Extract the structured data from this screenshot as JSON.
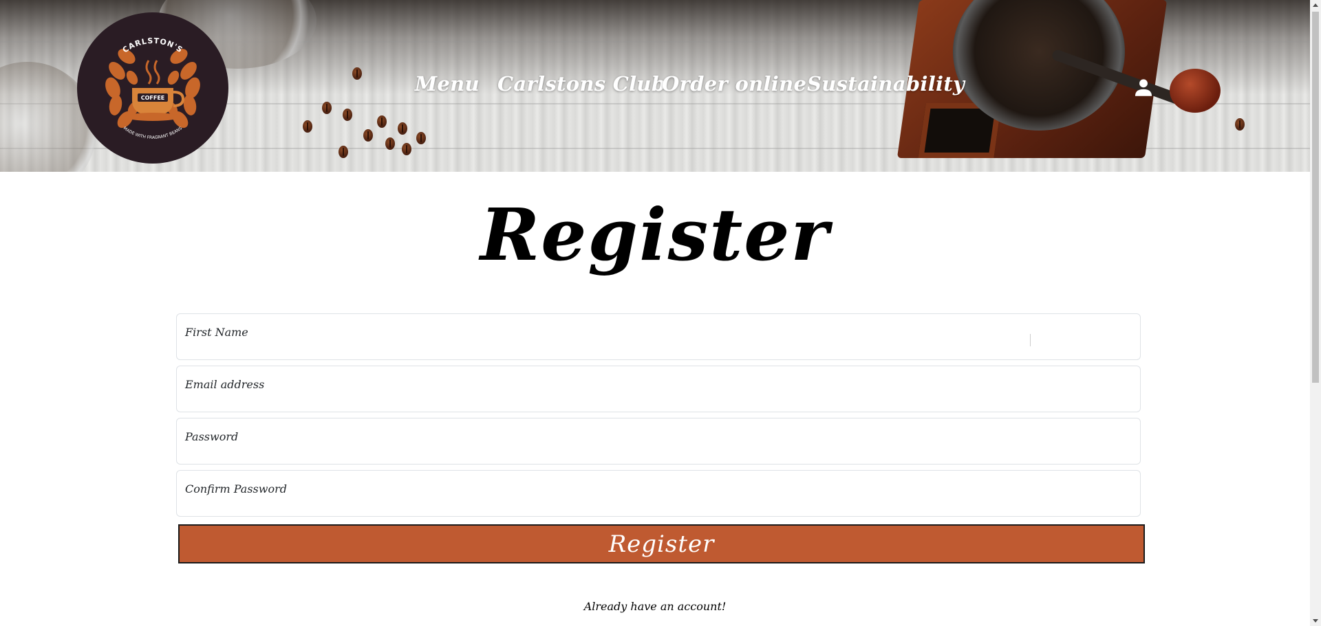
{
  "header": {
    "logo": {
      "top_text": "CARLSTON'S",
      "center_text": "COFFEE",
      "bottom_text": "MADE WITH FRAGRANT BEANS"
    },
    "nav": [
      {
        "label": "Menu"
      },
      {
        "label": "Carlstons Club"
      },
      {
        "label": "Order online"
      },
      {
        "label": "Sustainability"
      }
    ],
    "account_icon": "account-icon"
  },
  "form": {
    "title": "Register",
    "fields": [
      {
        "label": "First Name",
        "value": ""
      },
      {
        "label": "Email address",
        "value": ""
      },
      {
        "label": "Password",
        "value": ""
      },
      {
        "label": "Confirm Password",
        "value": ""
      }
    ],
    "submit_label": "Register",
    "login_prompt": "Already have an account!"
  },
  "colors": {
    "accent": "#bf5a31",
    "logo_bg": "#2a1c24",
    "logo_orange": "#c8672a",
    "text": "#000000"
  }
}
